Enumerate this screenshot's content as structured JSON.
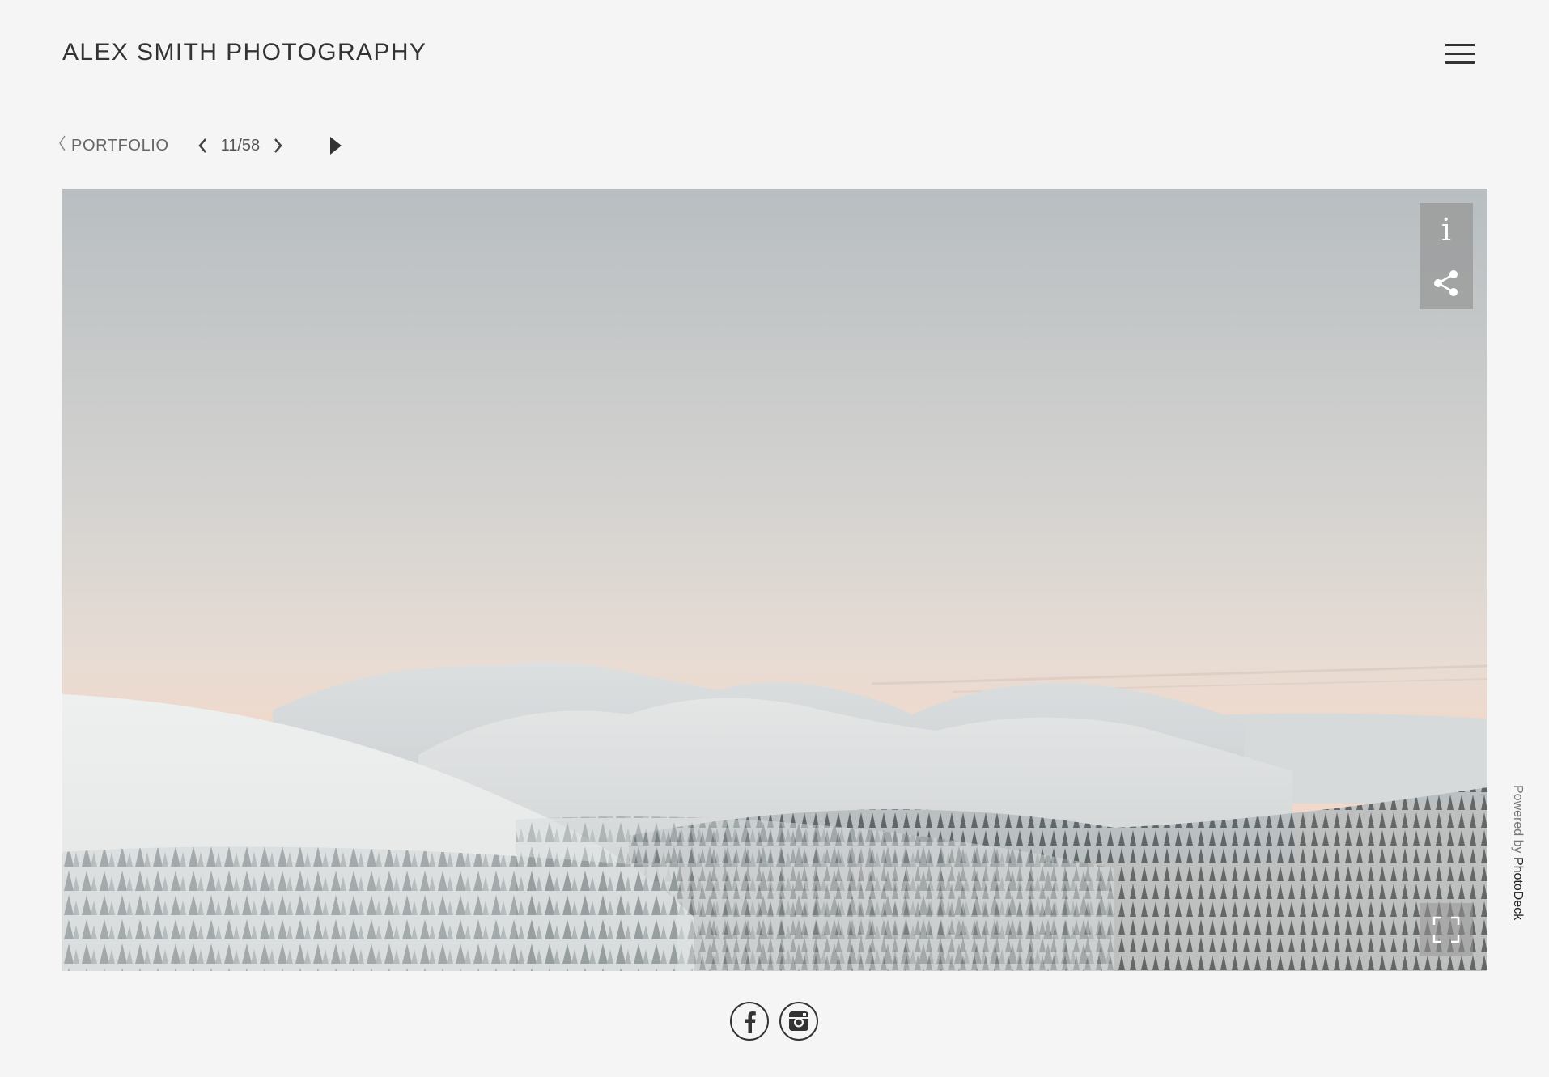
{
  "header": {
    "site_title": "ALEX SMITH PHOTOGRAPHY",
    "menu_icon": "hamburger-menu-icon"
  },
  "nav": {
    "back_label": "PORTFOLIO",
    "counter": "11/58",
    "current_index": 11,
    "total": 58,
    "icons": {
      "back": "chevron-left-icon",
      "prev": "chevron-left-icon",
      "next": "chevron-right-icon",
      "play": "play-icon"
    }
  },
  "photo": {
    "subject": "snow-covered fells and forest at dusk",
    "tools": {
      "info_label": "i",
      "share_icon": "share-icon",
      "fullscreen_icon": "fullscreen-icon"
    }
  },
  "footer": {
    "social": [
      {
        "name": "facebook",
        "icon": "facebook-icon",
        "glyph": "f"
      },
      {
        "name": "instagram",
        "icon": "instagram-icon"
      }
    ],
    "powered_prefix": "Powered by ",
    "powered_brand": "PhotoDeck"
  },
  "colors": {
    "background": "#f5f5f5",
    "text": "#333333",
    "sky_top": "#b8bec1",
    "sky_glow": "#f1d9cc",
    "snow": "#e9ebeb"
  }
}
